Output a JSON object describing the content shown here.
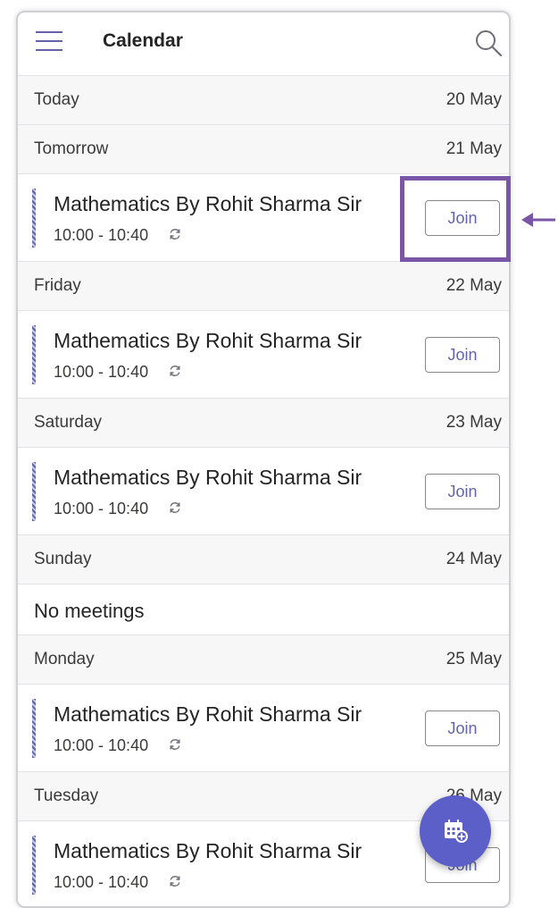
{
  "header": {
    "title": "Calendar",
    "menu_icon": "hamburger-menu-icon",
    "search_icon": "search-icon"
  },
  "days": [
    {
      "name": "Today",
      "date": "20 May",
      "meetings": []
    },
    {
      "name": "Tomorrow",
      "date": "21 May",
      "meetings": [
        {
          "title": "Mathematics By Rohit Sharma Sir",
          "time": "10:00 - 10:40",
          "join_label": "Join",
          "recurring": true
        }
      ]
    },
    {
      "name": "Friday",
      "date": "22 May",
      "meetings": [
        {
          "title": "Mathematics By Rohit Sharma Sir",
          "time": "10:00 - 10:40",
          "join_label": "Join",
          "recurring": true
        }
      ]
    },
    {
      "name": "Saturday",
      "date": "23 May",
      "meetings": [
        {
          "title": "Mathematics By Rohit Sharma Sir",
          "time": "10:00 - 10:40",
          "join_label": "Join",
          "recurring": true
        }
      ]
    },
    {
      "name": "Sunday",
      "date": "24 May",
      "meetings": [],
      "empty_text": "No meetings"
    },
    {
      "name": "Monday",
      "date": "25 May",
      "meetings": [
        {
          "title": "Mathematics By Rohit Sharma Sir",
          "time": "10:00 - 10:40",
          "join_label": "Join",
          "recurring": true
        }
      ]
    },
    {
      "name": "Tuesday",
      "date": "26 May",
      "meetings": [
        {
          "title": "Mathematics By Rohit Sharma Sir",
          "time": "10:00 - 10:40",
          "join_label": "Join",
          "recurring": true
        }
      ]
    }
  ],
  "fab": {
    "icon": "new-meeting-calendar-icon"
  },
  "annotation": {
    "highlight_color": "#7a56a6",
    "arrow_icon": "left-arrow-icon"
  },
  "colors": {
    "accent": "#6264a7",
    "fab": "#5b5fc7"
  }
}
